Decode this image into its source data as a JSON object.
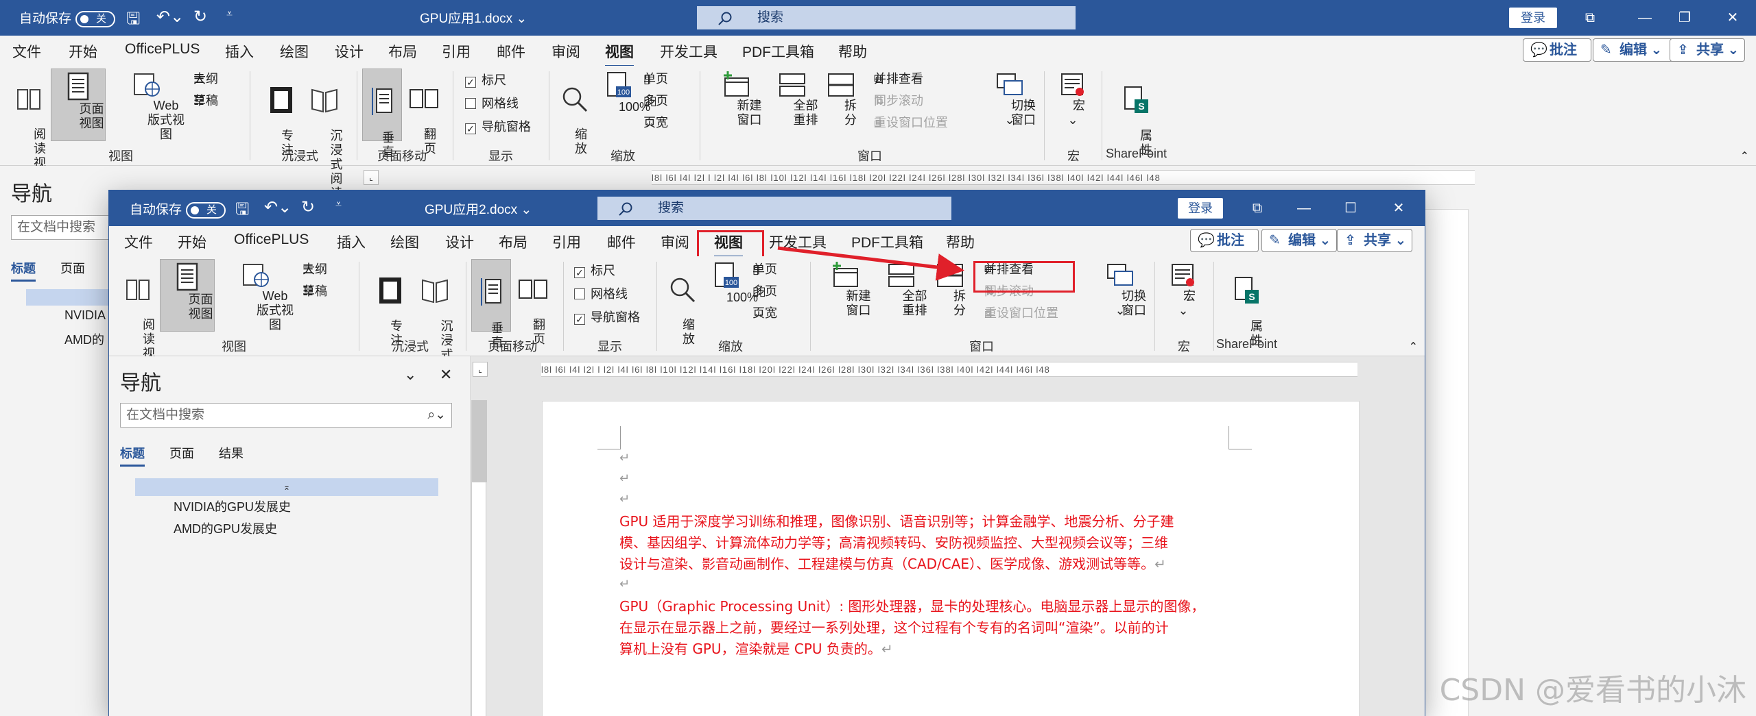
{
  "back_window": {
    "title": "GPU应用1.docx",
    "autosave_label": "自动保存",
    "autosave_state": "关",
    "search_text": "搜索",
    "login": "登录",
    "tabs": [
      "文件",
      "开始",
      "OfficePLUS",
      "插入",
      "绘图",
      "设计",
      "布局",
      "引用",
      "邮件",
      "审阅",
      "视图",
      "开发工具",
      "PDF工具箱",
      "帮助"
    ],
    "active_tab": "视图",
    "ribbon_buttons": {
      "comment": "批注",
      "edit": "编辑",
      "share": "共享"
    },
    "ribbon": {
      "read_view": "阅读\n视图",
      "print_view": "页面视图",
      "web_view": "Web 版式视图",
      "outline": "大纲",
      "draft": "草稿",
      "focus": "专\n注",
      "immersive_reader": "沉浸式\n阅读器",
      "vertical": "垂\n直",
      "side_to_side": "翻\n页",
      "ruler": "标尺",
      "gridlines": "网格线",
      "nav_pane": "导航窗格",
      "zoom": "缩\n放",
      "hundred": "100%",
      "one_page": "单页",
      "multi_page": "多页",
      "page_width": "页宽",
      "new_window": "新建窗口",
      "arrange_all": "全部重排",
      "split": "拆分",
      "side_by_side": "并排查看",
      "sync_scroll": "同步滚动",
      "reset_position": "重设窗口位置",
      "switch_windows": "切换窗口",
      "macros": "宏",
      "properties": "属性"
    },
    "groups": {
      "views": "视图",
      "immersive": "沉浸式",
      "page_movement": "页面移动",
      "show": "显示",
      "zoom": "缩放",
      "window": "窗口",
      "macros": "宏",
      "sharepoint": "SharePoint"
    },
    "nav": {
      "title": "导航",
      "search_placeholder": "在文档中搜索",
      "tab_headings": "标题",
      "tab_pages": "页面",
      "item1": "NVIDIA",
      "item2": "AMD的"
    }
  },
  "front_window": {
    "title": "GPU应用2.docx",
    "autosave_label": "自动保存",
    "autosave_state": "关",
    "search_text": "搜索",
    "login": "登录",
    "tabs": [
      "文件",
      "开始",
      "OfficePLUS",
      "插入",
      "绘图",
      "设计",
      "布局",
      "引用",
      "邮件",
      "审阅",
      "视图",
      "开发工具",
      "PDF工具箱",
      "帮助"
    ],
    "active_tab": "视图",
    "ribbon_buttons": {
      "comment": "批注",
      "edit": "编辑",
      "share": "共享"
    },
    "ribbon": {
      "read_view": "阅读\n视图",
      "print_view": "页面视图",
      "web_view": "Web 版式视图",
      "outline": "大纲",
      "draft": "草稿",
      "focus": "专\n注",
      "immersive_reader": "沉浸式\n阅读器",
      "vertical": "垂\n直",
      "side_to_side": "翻\n页",
      "ruler": "标尺",
      "gridlines": "网格线",
      "nav_pane": "导航窗格",
      "zoom": "缩\n放",
      "hundred": "100%",
      "one_page": "单页",
      "multi_page": "多页",
      "page_width": "页宽",
      "new_window": "新建窗口",
      "arrange_all": "全部重排",
      "split": "拆分",
      "side_by_side": "并排查看",
      "sync_scroll": "同步滚动",
      "reset_position": "重设窗口位置",
      "switch_windows": "切换窗口",
      "macros": "宏",
      "properties": "属性"
    },
    "groups": {
      "views": "视图",
      "immersive": "沉浸式",
      "page_movement": "页面移动",
      "show": "显示",
      "zoom": "缩放",
      "window": "窗口",
      "macros": "宏",
      "sharepoint": "SharePoint"
    },
    "nav": {
      "title": "导航",
      "search_placeholder": "在文档中搜索",
      "tab_headings": "标题",
      "tab_pages": "页面",
      "tab_results": "结果",
      "item1": "NVIDIA的GPU发展史",
      "item2": "AMD的GPU发展史"
    },
    "document": {
      "para1_line1": "GPU 适用于深度学习训练和推理，图像识别、语音识别等；计算金融学、地震分析、分子建",
      "para1_line2": "模、基因组学、计算流体动力学等；高清视频转码、安防视频监控、大型视频会议等；三维",
      "para1_line3": "设计与渲染、影音动画制作、工程建模与仿真（CAD/CAE）、医学成像、游戏测试等等。",
      "para2_line1": "GPU（Graphic Processing Unit）: 图形处理器，显卡的处理核心。电脑显示器上显示的图像，",
      "para2_line2": "在显示在显示器上之前，要经过一系列处理，这个过程有个专有的名词叫“渲染”。以前的计",
      "para2_line3": "算机上没有 GPU，渲染就是 CPU 负责的。",
      "para_mark": "↵"
    },
    "ruler_text": "l8l l6l l4l l2l l  l2l l4l l6l l8l l10l l12l l14l l16l l18l l20l l22l l24l l26l l28l l30l l32l l34l l36l l38l l40l l42l l44l l46l l48"
  },
  "watermark": "CSDN @爱看书的小沐",
  "colors": {
    "title_bar": "#2b579a",
    "highlight": "#e0202a",
    "doc_text": "#e8141c"
  }
}
